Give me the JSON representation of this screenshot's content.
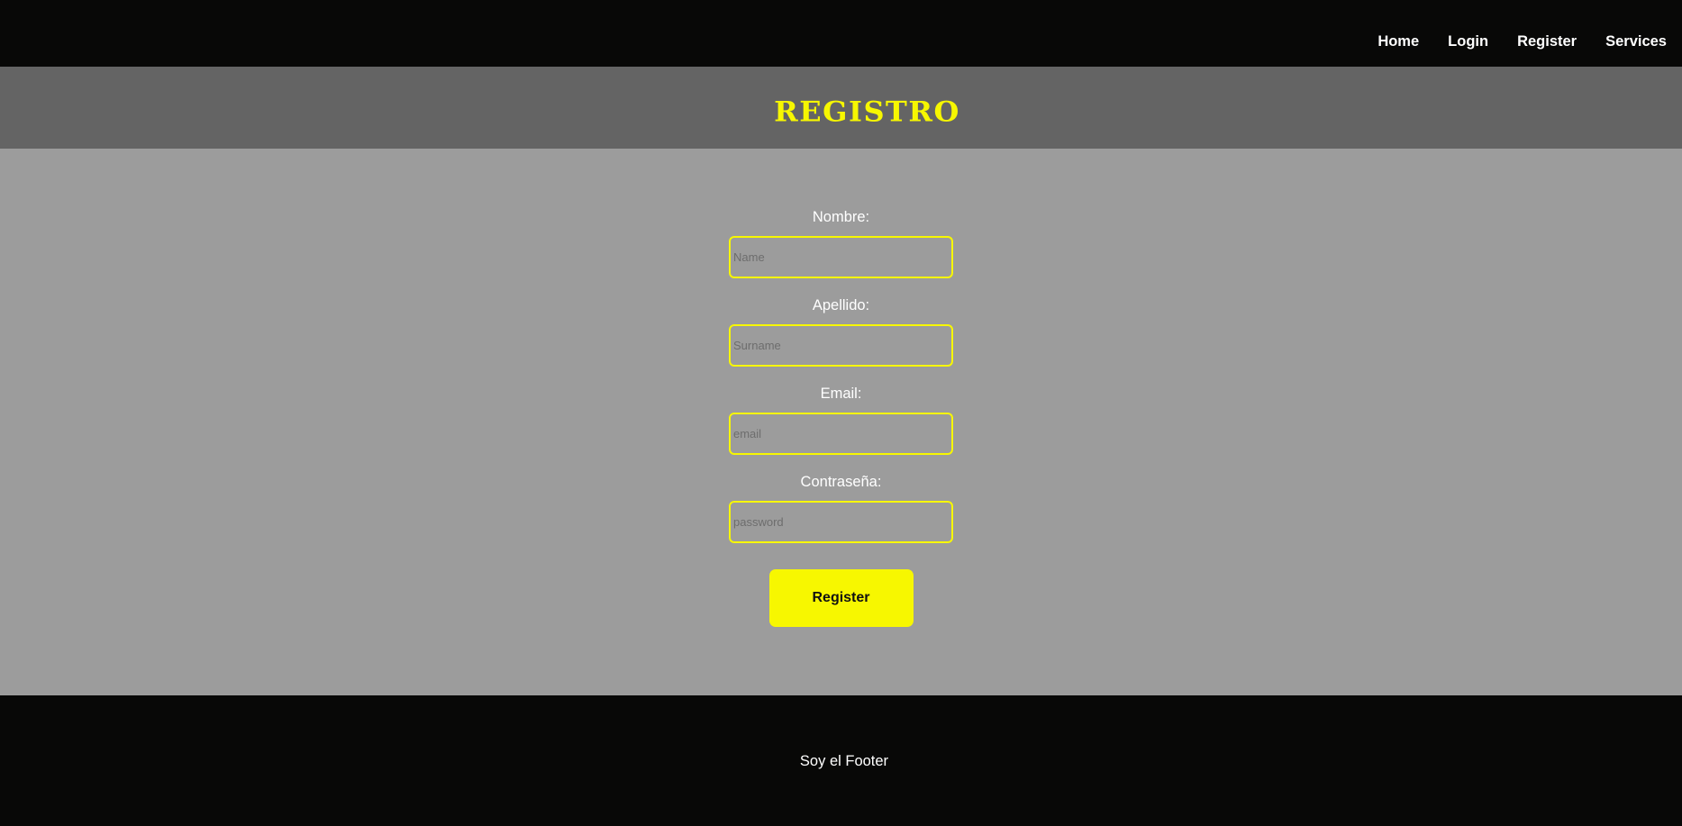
{
  "nav": {
    "items": [
      {
        "label": "Home"
      },
      {
        "label": "Login"
      },
      {
        "label": "Register"
      },
      {
        "label": "Services"
      }
    ]
  },
  "header": {
    "title": "REGISTRO"
  },
  "form": {
    "fields": [
      {
        "label": "Nombre:",
        "placeholder": "Name",
        "value": ""
      },
      {
        "label": "Apellido:",
        "placeholder": "Surname",
        "value": ""
      },
      {
        "label": "Email:",
        "placeholder": "email",
        "value": ""
      },
      {
        "label": "Contraseña:",
        "placeholder": "password",
        "value": ""
      }
    ],
    "submit_label": "Register"
  },
  "footer": {
    "text": "Soy el Footer"
  },
  "colors": {
    "accent": "#f7f700",
    "navbar_bg": "#080807",
    "title_band_bg": "#646464",
    "main_bg": "#9c9c9c",
    "footer_bg": "#080807"
  }
}
